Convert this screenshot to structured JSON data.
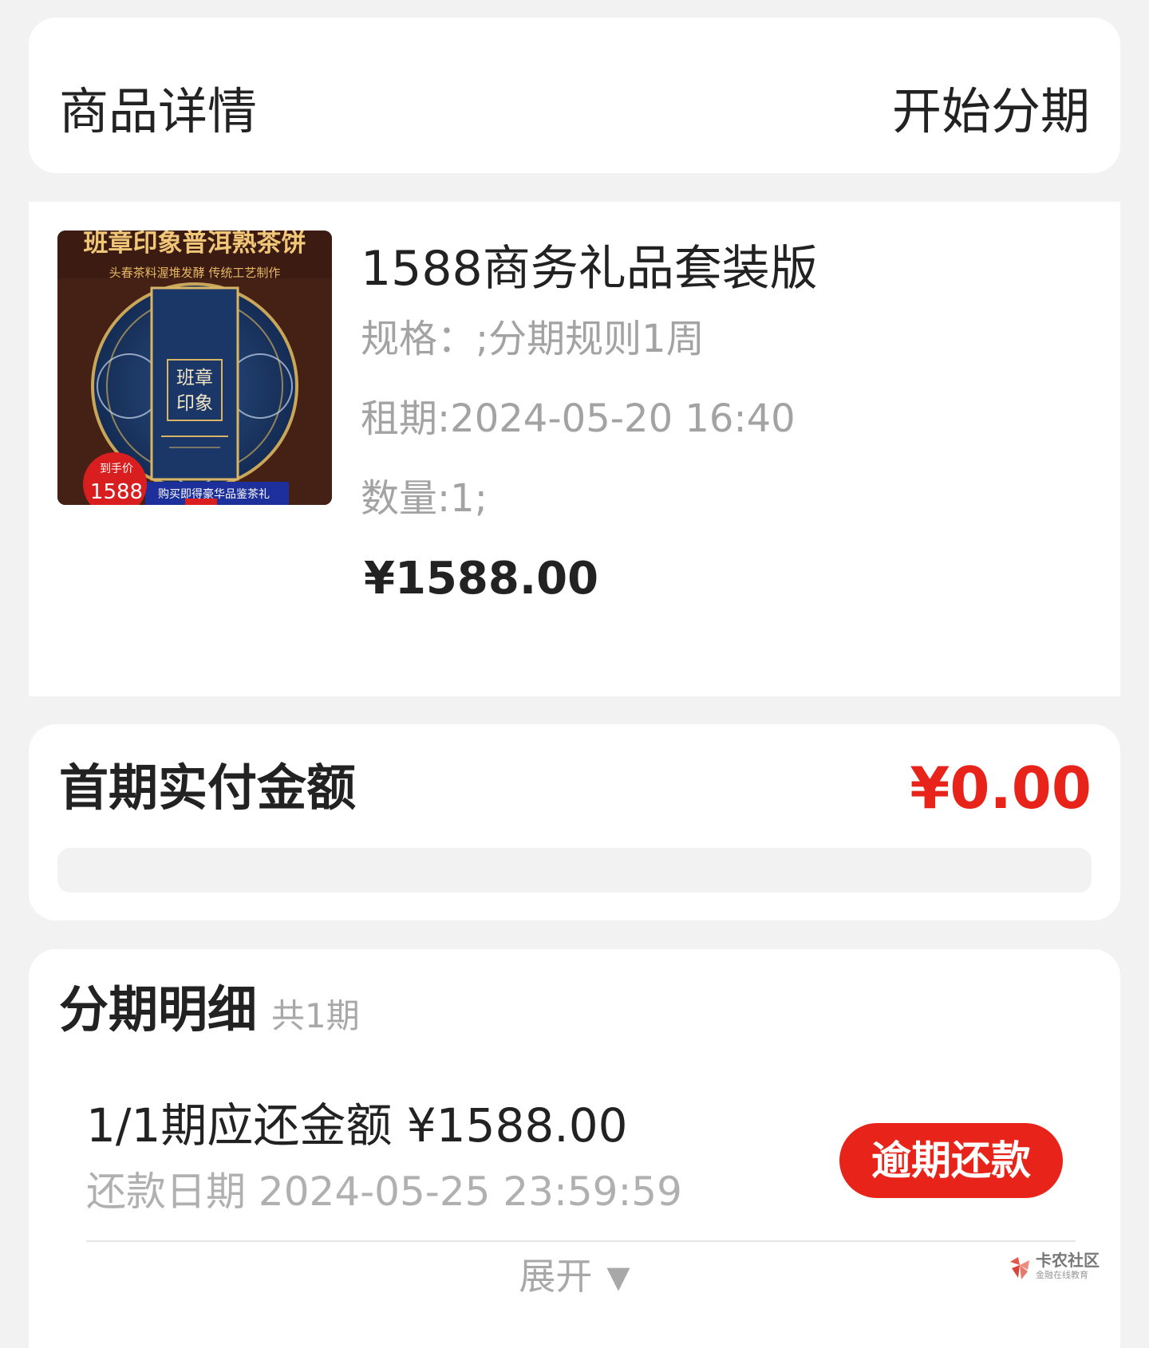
{
  "header": {
    "title": "商品详情",
    "action": "开始分期"
  },
  "product": {
    "image": {
      "headline": "班章印象普洱熟茶饼",
      "subline": "头春茶料渥堆发酵 传统工艺制作",
      "center_line1": "班章",
      "center_line2": "印象",
      "badge_label": "到手价",
      "badge_price": "1588",
      "promo": "购买即得豪华品鉴茶礼"
    },
    "name": "1588商务礼品套装版",
    "spec": "规格：;分期规则1周",
    "lease": "租期:2024-05-20 16:40",
    "quantity": "数量:1;",
    "price": "¥1588.00"
  },
  "first_payment": {
    "label": "首期实付金额",
    "amount": "¥0.00"
  },
  "installments": {
    "title": "分期明细",
    "count": "共1期",
    "items": [
      {
        "amount_text": "1/1期应还金额 ¥1588.00",
        "due_text": "还款日期 2024-05-25 23:59:59",
        "status_button": "逾期还款"
      }
    ],
    "expand_label": "展开"
  },
  "watermark": {
    "name": "卡农社区",
    "sub": "金融在线教育"
  },
  "colors": {
    "accent_red": "#e8231a",
    "page_bg": "#f2f2f2",
    "muted_text": "#a3a3a3"
  }
}
